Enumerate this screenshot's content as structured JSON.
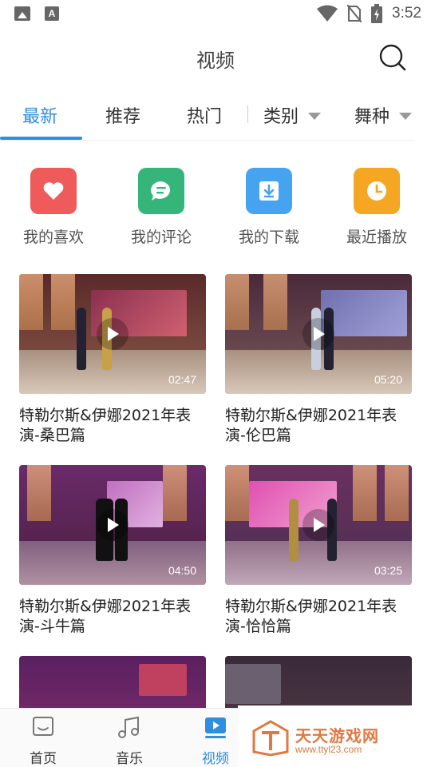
{
  "status_bar": {
    "time": "3:52",
    "notif_icon_letter": "A"
  },
  "header": {
    "title": "视频"
  },
  "tabs": [
    {
      "label": "最新",
      "active": true
    },
    {
      "label": "推荐"
    },
    {
      "label": "热门"
    },
    {
      "label": "类别",
      "dropdown": true
    },
    {
      "label": "舞种",
      "dropdown": true
    }
  ],
  "quick_actions": [
    {
      "label": "我的喜欢",
      "icon": "heart-icon",
      "color": "#ef5a5a"
    },
    {
      "label": "我的评论",
      "icon": "comment-icon",
      "color": "#36b57a"
    },
    {
      "label": "我的下载",
      "icon": "download-icon",
      "color": "#46a3f0"
    },
    {
      "label": "最近播放",
      "icon": "clock-icon",
      "color": "#f5a623"
    }
  ],
  "videos": [
    {
      "title": "特勒尔斯&伊娜2021年表演-桑巴篇",
      "duration": "02:47"
    },
    {
      "title": "特勒尔斯&伊娜2021年表演-伦巴篇",
      "duration": "05:20"
    },
    {
      "title": "特勒尔斯&伊娜2021年表演-斗牛篇",
      "duration": "04:50"
    },
    {
      "title": "特勒尔斯&伊娜2021年表演-恰恰篇",
      "duration": "03:25"
    }
  ],
  "bottom_nav": [
    {
      "label": "首页",
      "icon": "home-icon"
    },
    {
      "label": "音乐",
      "icon": "music-icon"
    },
    {
      "label": "视频",
      "icon": "video-icon",
      "active": true
    }
  ],
  "watermark": {
    "text": "天天游戏网",
    "url": "www.ttyl23.com"
  },
  "colors": {
    "accent": "#2f8ee0"
  }
}
